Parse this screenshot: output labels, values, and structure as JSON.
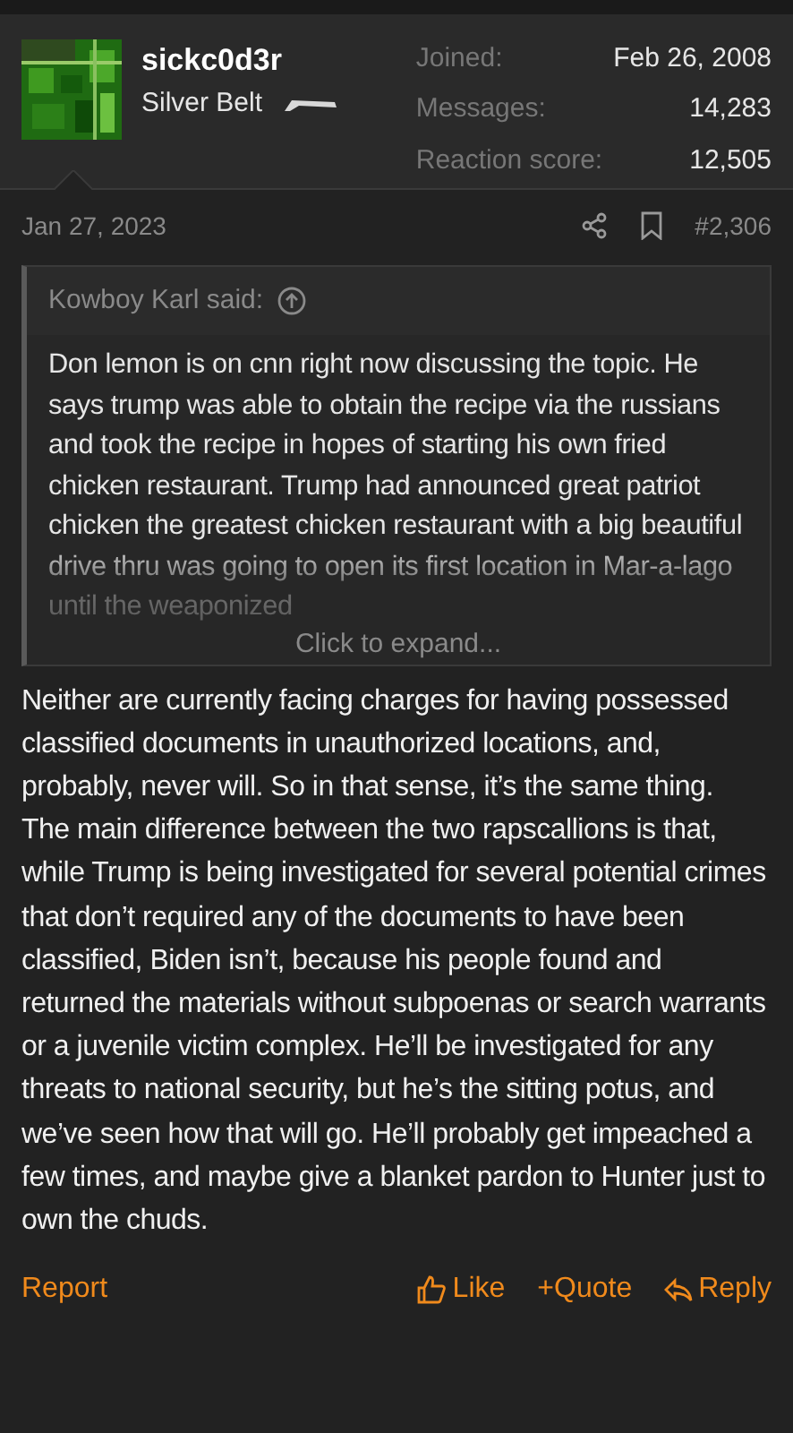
{
  "user": {
    "name": "sickc0d3r",
    "title": "Silver Belt",
    "stats": [
      {
        "label": "Joined:",
        "value": "Feb 26, 2008"
      },
      {
        "label": "Messages:",
        "value": "14,283"
      },
      {
        "label": "Reaction score:",
        "value": "12,505"
      }
    ]
  },
  "post": {
    "date": "Jan 27, 2023",
    "number": "#2,306",
    "quote": {
      "author": "Kowboy Karl said:",
      "text": "Don lemon is on cnn right now discussing the topic. He says trump was able to obtain the recipe via the russians and took the recipe in hopes of starting his own fried chicken restaurant. Trump had announced great patriot chicken the greatest chicken restaurant with a big beautiful drive thru was going to open its first location in Mar-a-lago until the weaponized",
      "expand": "Click to expand..."
    },
    "paragraphs": [
      "Neither are currently facing charges for having possessed classified documents in unauthorized locations, and, probably, never will. So in that sense, it’s the same thing.",
      "The main difference between the two rapscallions is that, while Trump is being investigated for several potential crimes that don’t required any of the documents to have been classified, Biden isn’t, because his people found and returned the materials without subpoenas or search warrants or a juvenile victim complex. He’ll be investigated for any threats to national security, but he’s the sitting potus, and we’ve seen how that will go. He’ll probably get impeached a few times, and maybe give a blanket pardon to Hunter just to own the chuds."
    ],
    "actions": {
      "report": "Report",
      "like": "Like",
      "quote": "+Quote",
      "reply": "Reply"
    }
  }
}
